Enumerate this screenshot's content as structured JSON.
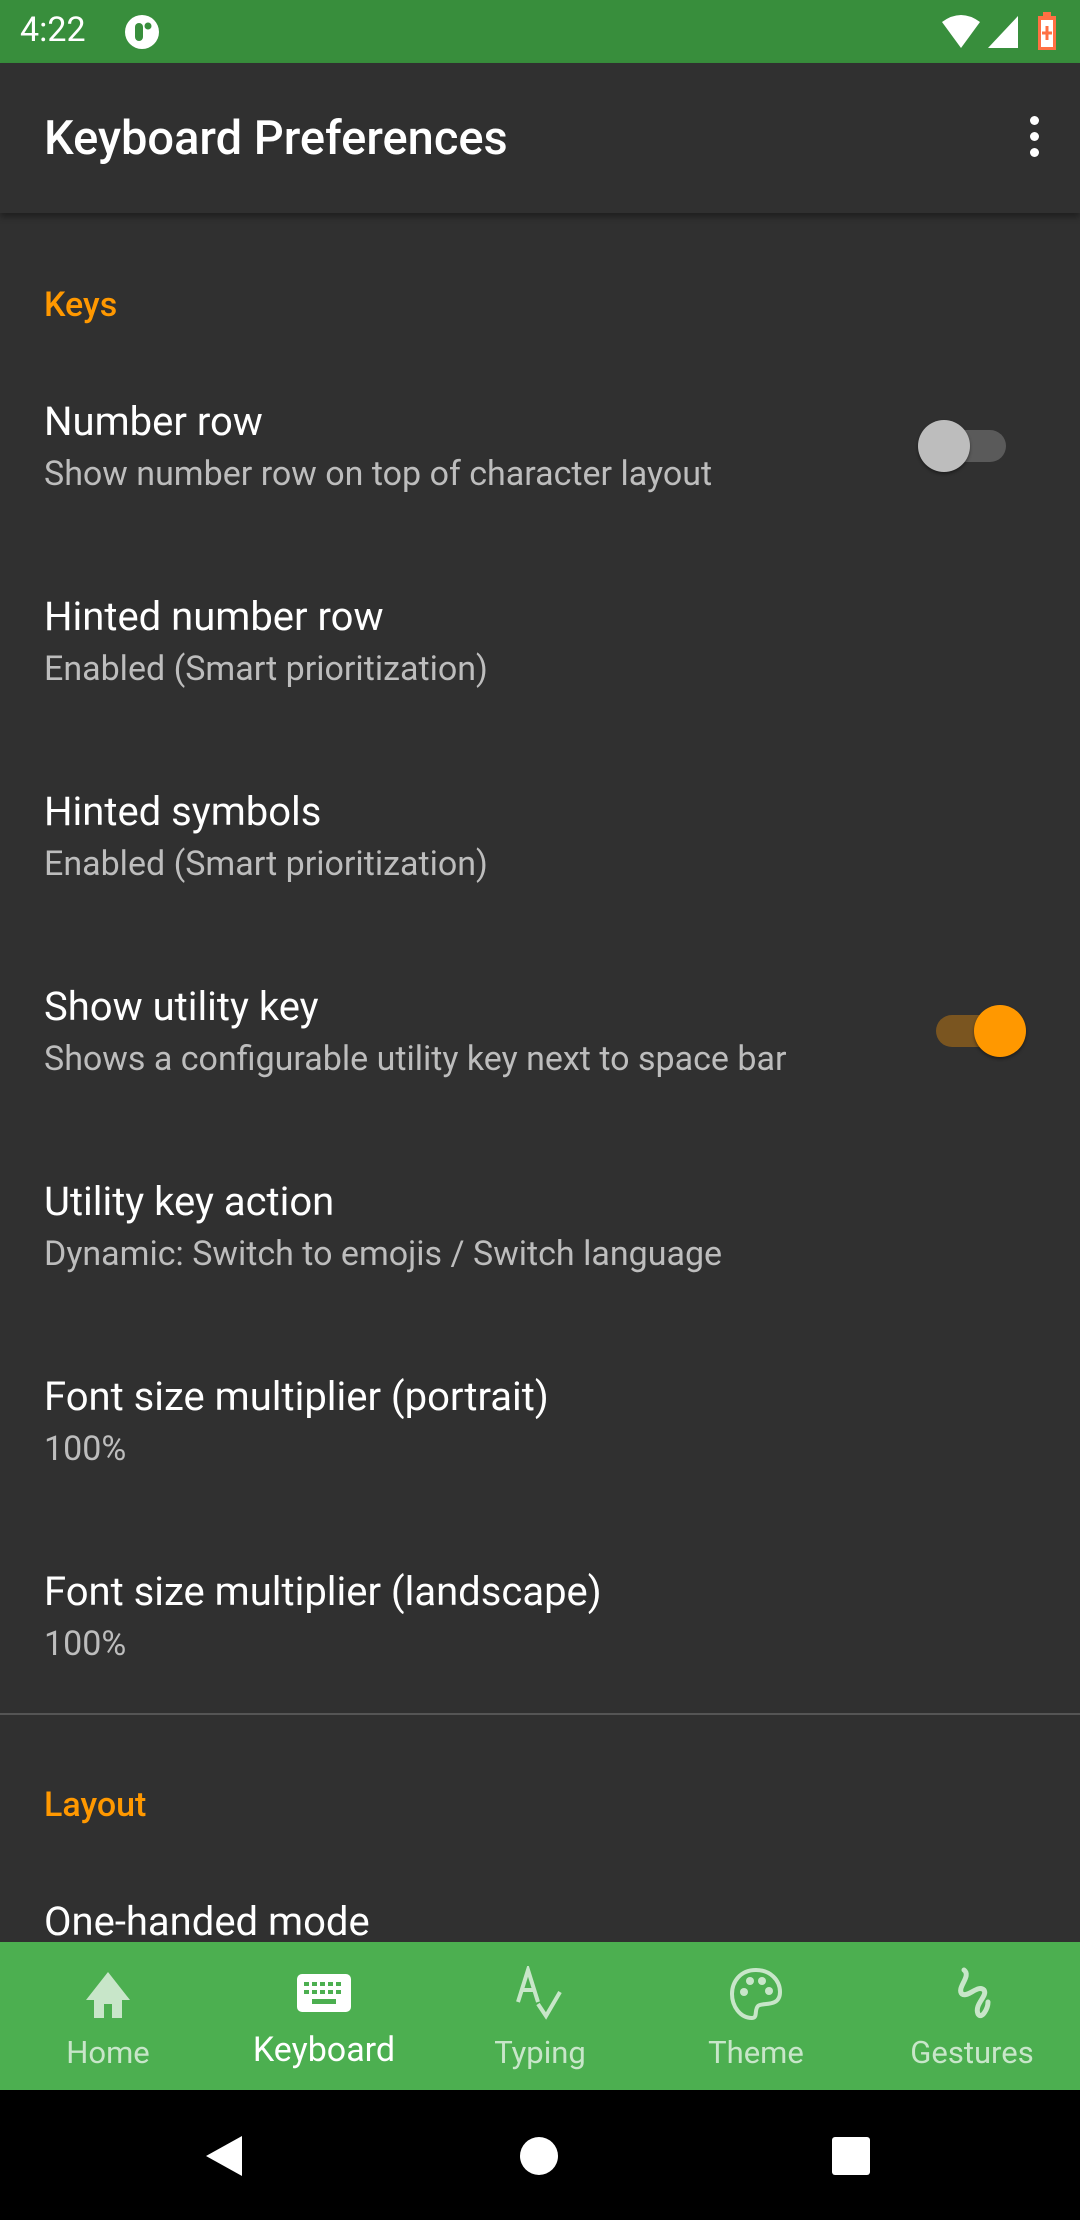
{
  "status_bar": {
    "time": "4:22",
    "icons": [
      "app-notification-icon",
      "wifi-icon",
      "signal-icon",
      "battery-charging-icon"
    ],
    "battery_color": "#ff7043"
  },
  "app_bar": {
    "title": "Keyboard Preferences",
    "menu_icon": "more-vert-icon"
  },
  "colors": {
    "accent": "#ff9800",
    "status_bar": "#388e3c",
    "bottom_nav": "#4caf50",
    "background": "#303030"
  },
  "sections": [
    {
      "header": "Keys",
      "items": [
        {
          "title": "Number row",
          "summary": "Show number row on top of character layout",
          "switch": false
        },
        {
          "title": "Hinted number row",
          "summary": "Enabled (Smart prioritization)"
        },
        {
          "title": "Hinted symbols",
          "summary": "Enabled (Smart prioritization)"
        },
        {
          "title": "Show utility key",
          "summary": "Shows a configurable utility key next to space bar",
          "switch": true
        },
        {
          "title": "Utility key action",
          "summary": "Dynamic: Switch to emojis / Switch language"
        },
        {
          "title": "Font size multiplier (portrait)",
          "summary": "100%"
        },
        {
          "title": "Font size multiplier (landscape)",
          "summary": "100%"
        }
      ]
    },
    {
      "header": "Layout",
      "items": [
        {
          "title": "One-handed mode"
        }
      ]
    }
  ],
  "bottom_nav": [
    {
      "label": "Home",
      "icon": "home-icon"
    },
    {
      "label": "Keyboard",
      "icon": "keyboard-icon",
      "active": true
    },
    {
      "label": "Typing",
      "icon": "spellcheck-icon"
    },
    {
      "label": "Theme",
      "icon": "palette-icon"
    },
    {
      "label": "Gestures",
      "icon": "gesture-icon"
    }
  ],
  "nav_bar": [
    "back-icon",
    "home-circle-icon",
    "recents-icon"
  ]
}
